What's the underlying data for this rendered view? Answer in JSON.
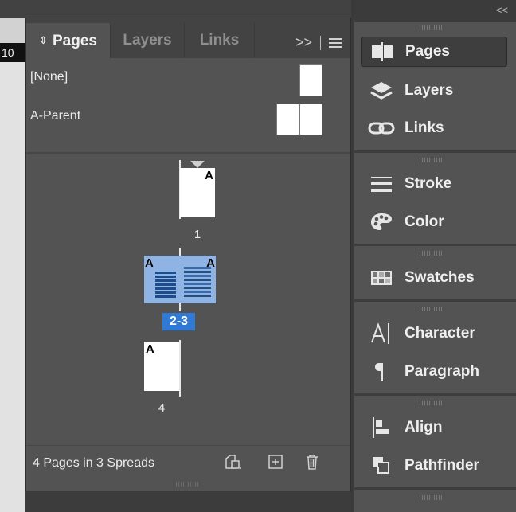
{
  "document": {
    "ruler_value": "10"
  },
  "pages_panel": {
    "tabs": [
      {
        "label": "Pages",
        "active": true
      },
      {
        "label": "Layers",
        "active": false
      },
      {
        "label": "Links",
        "active": false
      }
    ],
    "tab_menu": {
      "expand_symbol": ">>"
    },
    "parents": [
      {
        "label": "[None]"
      },
      {
        "label": "A-Parent"
      }
    ],
    "pages": [
      {
        "number": "1",
        "parent_prefix": "A"
      },
      {
        "number": "2-3",
        "parent_prefix": "A",
        "selected": true
      },
      {
        "number": "4",
        "parent_prefix": "A"
      }
    ],
    "footer": {
      "status": "4 Pages in 3 Spreads"
    }
  },
  "dock": {
    "collapse_symbol": "<<",
    "items": [
      {
        "label": "Pages",
        "icon": "pages-icon",
        "active": true
      },
      {
        "label": "Layers",
        "icon": "layers-icon"
      },
      {
        "label": "Links",
        "icon": "links-icon"
      },
      {
        "label": "Stroke",
        "icon": "stroke-icon"
      },
      {
        "label": "Color",
        "icon": "palette-icon"
      },
      {
        "label": "Swatches",
        "icon": "swatches-icon"
      },
      {
        "label": "Character",
        "icon": "character-icon"
      },
      {
        "label": "Paragraph",
        "icon": "paragraph-icon"
      },
      {
        "label": "Align",
        "icon": "align-icon"
      },
      {
        "label": "Pathfinder",
        "icon": "pathfinder-icon"
      }
    ]
  },
  "colors": {
    "panel_bg": "#535353",
    "selection_blue": "#2f7ad6",
    "spread_highlight": "#8fb4e3"
  }
}
